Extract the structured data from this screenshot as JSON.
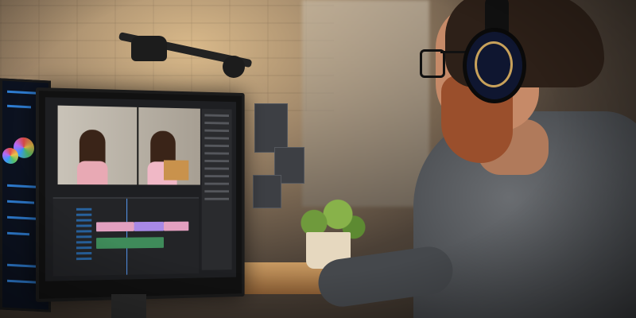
{
  "scene": {
    "description_tags": [
      "video-editing-desk",
      "man-with-headphones",
      "timeline-editor"
    ],
    "colors": {
      "wall": "#9a8266",
      "desk": "#b7854f",
      "shirt": "#4c4f53",
      "hair": "#2d2018",
      "beard": "#9a4f2c",
      "headphone_ring": "#c8a15a",
      "ui_accent": "#2f7fd6",
      "clip_pink": "#e3a0c0",
      "clip_purple": "#a889e6",
      "clip_green": "#3f8b5a"
    }
  }
}
